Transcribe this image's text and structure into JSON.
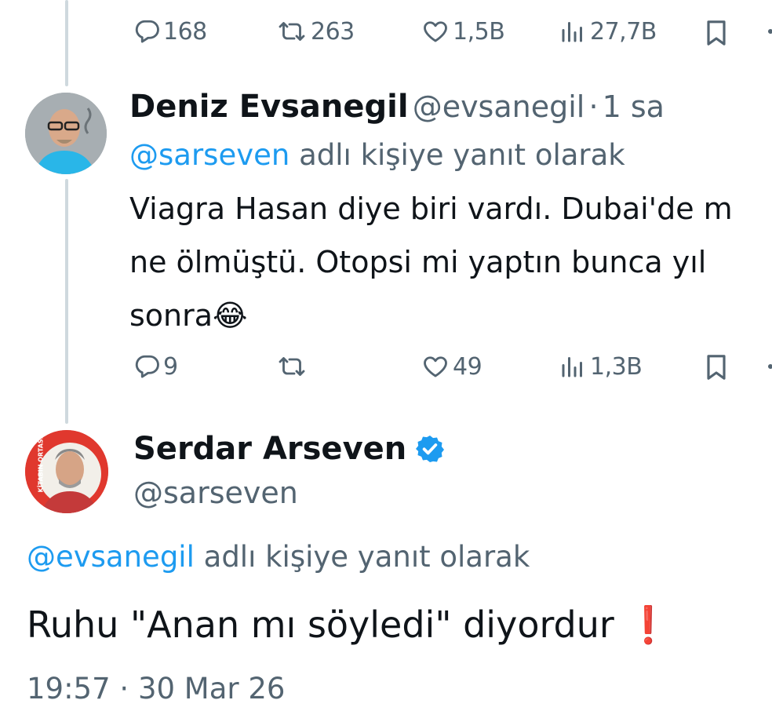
{
  "top_tweet": {
    "actions": {
      "replies": "168",
      "retweets": "263",
      "likes": "1,5B",
      "views": "27,7B"
    }
  },
  "reply_tweet": {
    "author_name": "Deniz Evsanegil",
    "author_handle": "@evsanegil",
    "separator": "·",
    "time": "1 sa",
    "reply_to_handle": "@sarseven",
    "reply_to_suffix": "adlı kişiye yanıt olarak",
    "text_line1": "Viagra Hasan diye biri vardı. Dubai'de m",
    "text_line2": "ne ölmüştü. Otopsi mi yaptın bunca yıl",
    "text_line3": "sonra",
    "emoji": "😂",
    "actions": {
      "replies": "9",
      "retweets": "",
      "likes": "49",
      "views": "1,3B"
    }
  },
  "main_tweet": {
    "author_name": "Serdar Arseven",
    "author_handle": "@sarseven",
    "verified": true,
    "avatar_ring_text": "KİTABIN ORTASI",
    "reply_to_handle": "@evsanegil",
    "reply_to_suffix": "adlı kişiye yanıt olarak",
    "text": "Ruhu \"Anan mı söyledi\" diyordur",
    "emoji": "❗",
    "time": "19:57",
    "separator": "·",
    "date": "30 Mar 26"
  },
  "colors": {
    "link": "#1d9bf0",
    "muted": "#536471",
    "thread_line": "#cfd9de",
    "verified": "#1d9bf0"
  }
}
